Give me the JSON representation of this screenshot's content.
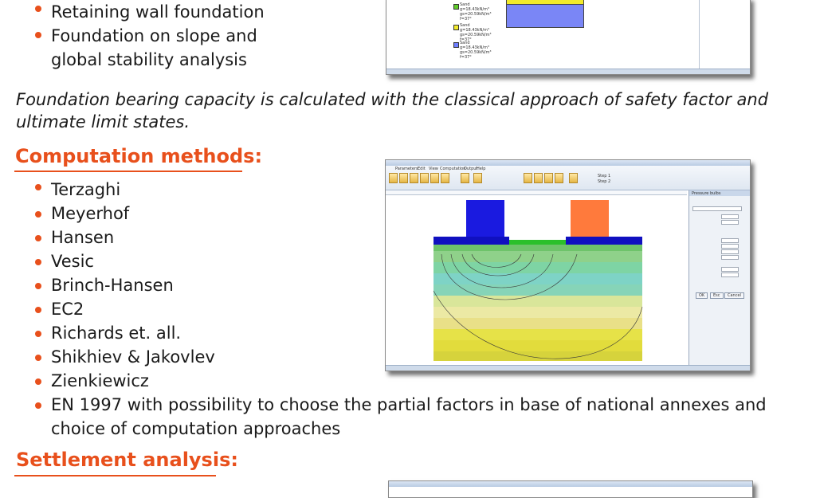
{
  "top_bullets": [
    "Retaining wall foundation",
    "Foundation on slope and",
    "global stability analysis"
  ],
  "intro_paragraph": {
    "line1": "Foundation bearing capacity is calculated with the classical approach of safety factor and",
    "line2": "ultimate limit states."
  },
  "computation_heading": "Computation methods:",
  "methods": [
    "Terzaghi",
    "Meyerhof",
    "Hansen",
    "Vesic",
    "Brinch-Hansen",
    "EC2",
    "Richards et. all.",
    "Shikhiev & Jakovlev",
    "Zienkiewicz"
  ],
  "en1997": {
    "line1": "EN 1997 with possibility to choose the partial factors in base of national annexes and",
    "line2": "choice of computation approaches"
  },
  "settlement_heading": "Settlement analysis:",
  "top_screenshot": {
    "legend": [
      {
        "name": "Sand",
        "params": [
          "g=18.43kN/m³",
          "gs=20.59kN/m³",
          "f=37°"
        ],
        "color": "#5fcc2a"
      },
      {
        "name": "Sand",
        "params": [
          "g=18.43kN/m³",
          "gs=20.59kN/m³",
          "f=37°"
        ],
        "color": "#f2ea2a"
      },
      {
        "name": "Sand",
        "params": [
          "g=18.43kN/m³",
          "gs=20.59kN/m³",
          "f=37°"
        ],
        "color": "#6f7fff"
      }
    ]
  },
  "main_screenshot": {
    "ribbon_tabs": [
      "Parameters",
      "Edit",
      "View",
      "Computation",
      "Output",
      "Help"
    ],
    "panel_title": "Pressure bulbs",
    "step_labels": [
      "Step 1",
      "Step 2"
    ],
    "panel_buttons": [
      "OK",
      "Esc",
      "Cancel"
    ]
  },
  "colors": {
    "accent": "#e8501c",
    "foundation_left": "#1a1ae0",
    "foundation_right": "#ff7a3c",
    "base_slab": "#1010c0"
  }
}
